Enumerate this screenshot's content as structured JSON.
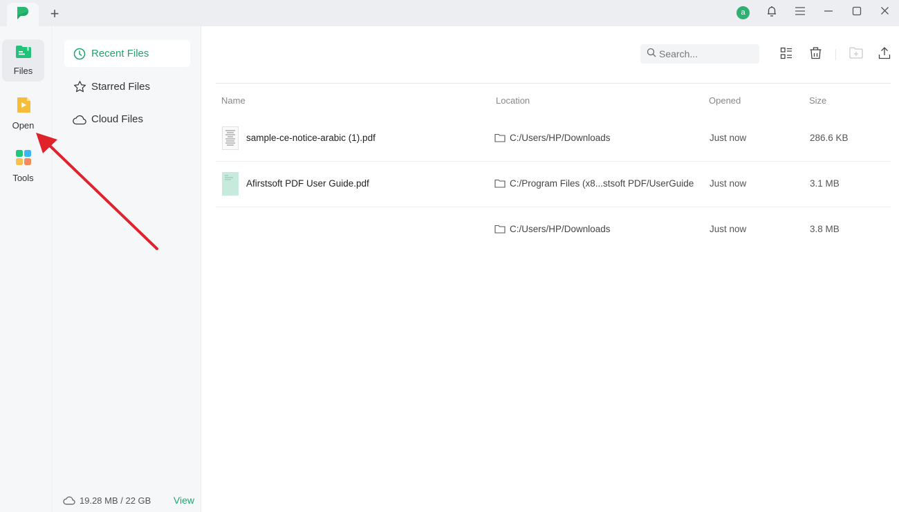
{
  "titlebar": {
    "add_tab_label": "+",
    "avatar_initial": "a",
    "icons": [
      "app-logo-icon",
      "bell-icon",
      "menu-icon",
      "minimize-icon",
      "maximize-icon",
      "close-icon"
    ]
  },
  "rail": {
    "items": [
      {
        "label": "Files",
        "icon": "files-folder-icon",
        "active": true
      },
      {
        "label": "Open",
        "icon": "open-file-icon",
        "active": false
      },
      {
        "label": "Tools",
        "icon": "tools-grid-icon",
        "active": false
      }
    ]
  },
  "subnav": {
    "items": [
      {
        "label": "Recent Files",
        "icon": "clock-icon",
        "active": true
      },
      {
        "label": "Starred Files",
        "icon": "star-icon",
        "active": false
      },
      {
        "label": "Cloud Files",
        "icon": "cloud-icon",
        "active": false
      }
    ],
    "storage": {
      "usage": "19.28 MB / 22 GB",
      "view_label": "View"
    }
  },
  "toolbar": {
    "search_placeholder": "Search...",
    "icons": [
      "list-view-icon",
      "trash-icon",
      "new-folder-icon",
      "upload-icon"
    ]
  },
  "table": {
    "headers": {
      "name": "Name",
      "location": "Location",
      "opened": "Opened",
      "size": "Size"
    },
    "rows": [
      {
        "name": "sample-ce-notice-arabic (1).pdf",
        "location": "C:/Users/HP/Downloads",
        "opened": "Just now",
        "size": "286.6 KB"
      },
      {
        "name": "Afirstsoft PDF User Guide.pdf",
        "location": "C:/Program Files (x8...stsoft PDF/UserGuide",
        "opened": "Just now",
        "size": "3.1 MB"
      },
      {
        "name": "",
        "location": "C:/Users/HP/Downloads",
        "opened": "Just now",
        "size": "3.8 MB"
      }
    ]
  },
  "colors": {
    "accent": "#20a46c",
    "annotation_arrow": "#e0232b"
  }
}
